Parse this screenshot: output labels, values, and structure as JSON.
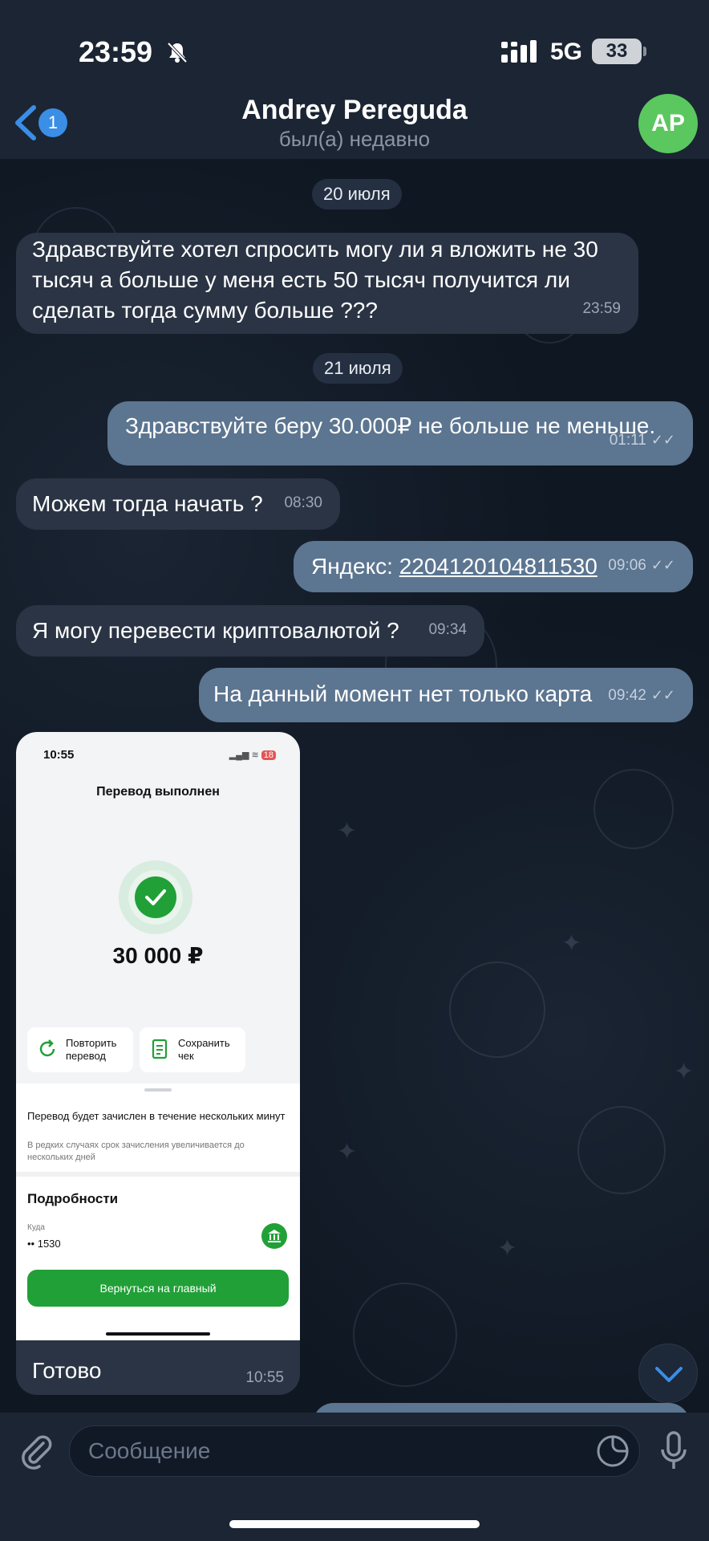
{
  "status_bar": {
    "time": "23:59",
    "network": "5G",
    "battery": "33"
  },
  "header": {
    "unread_count": "1",
    "contact_name": "Andrey Pereguda",
    "contact_status": "был(а) недавно",
    "avatar_initials": "AP"
  },
  "dates": [
    "20 июля",
    "21 июля"
  ],
  "messages": [
    {
      "text": "Здравствуйте хотел спросить могу ли я вложить не 30 тысяч а больше у меня есть 50 тысяч получится ли сделать тогда сумму больше ???",
      "time": "23:59",
      "direction": "in"
    },
    {
      "text": "Здравствуйте беру 30.000₽ не больше не меньше.",
      "time": "01:11",
      "direction": "out"
    },
    {
      "text": "Можем тогда начать ?",
      "time": "08:30",
      "direction": "in"
    },
    {
      "prefix": "Яндекс: ",
      "link": "2204120104811530",
      "time": "09:06",
      "direction": "out"
    },
    {
      "text": "Я могу перевести криптовалютой ?",
      "time": "09:34",
      "direction": "in"
    },
    {
      "text": "На данный момент нет только карта",
      "time": "09:42",
      "direction": "out"
    }
  ],
  "image_message": {
    "screenshot": {
      "time": "10:55",
      "status_badge": "18",
      "title": "Перевод выполнен",
      "amount": "30 000 ₽",
      "repeat_label": "Повторить перевод",
      "save_label": "Сохранить чек",
      "notice": "Перевод будет зачислен в течение нескольких минут",
      "notice_sub": "В редких случаях срок зачисления увеличивается до нескольких дней",
      "details_title": "Подробности",
      "to_label": "Куда",
      "to_value": "•• 1530",
      "home_button": "Вернуться на главный"
    },
    "caption": "Готово",
    "time": "10:55"
  },
  "input": {
    "placeholder": "Сообщение"
  },
  "colors": {
    "incoming_bubble": "#2a3444",
    "outgoing_bubble": "#5c7590",
    "avatar": "#5bc75f",
    "accent": "#3a8ee6",
    "sber_green": "#21a038"
  }
}
